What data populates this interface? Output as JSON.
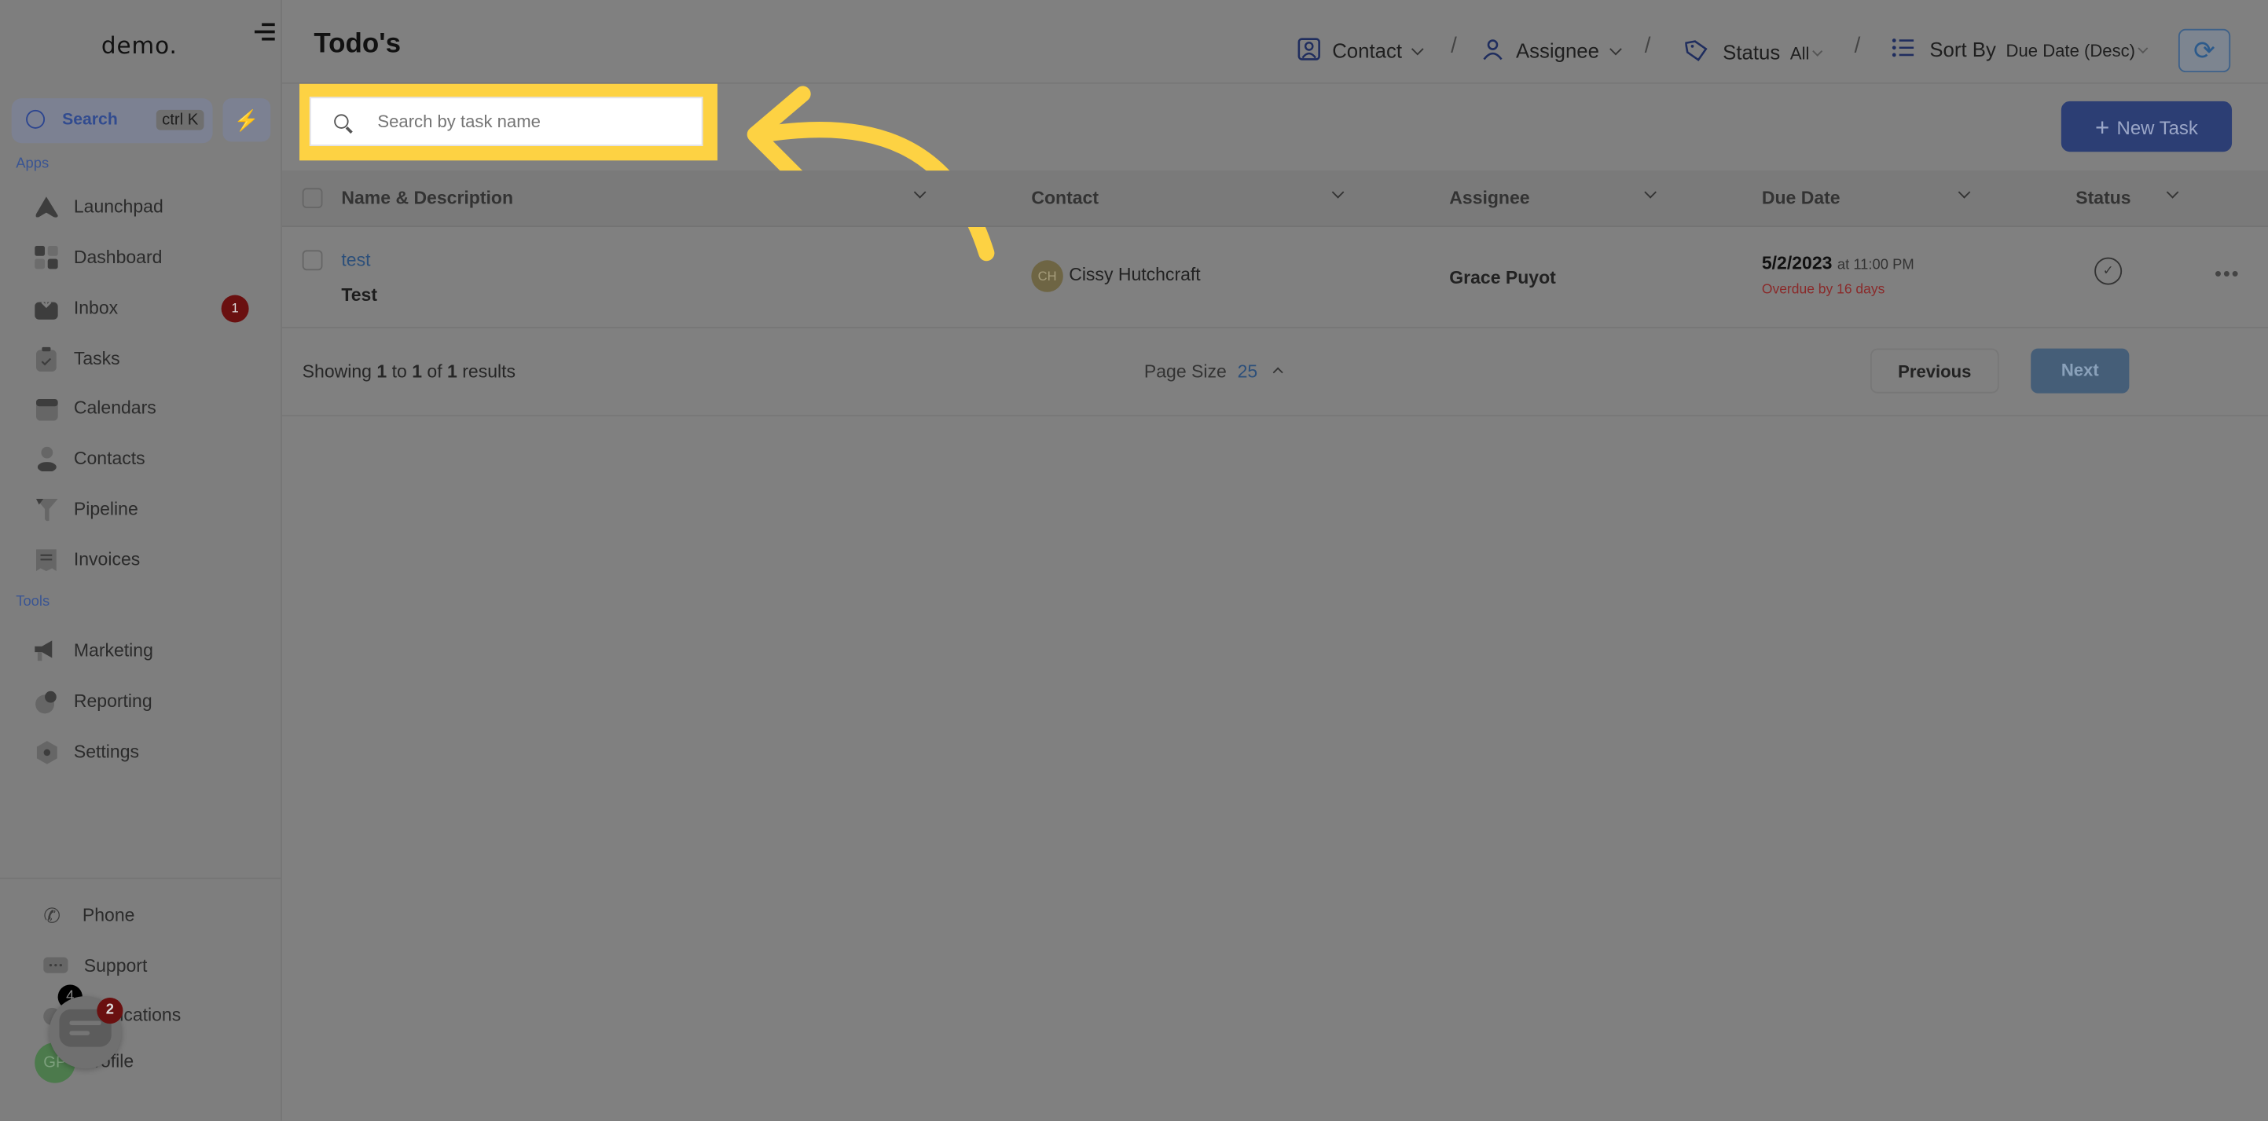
{
  "sidebar": {
    "logo": "demo.",
    "search": {
      "label": "Search",
      "shortcut": "ctrl K"
    },
    "sections": {
      "apps": "Apps",
      "tools": "Tools"
    },
    "apps": [
      {
        "label": "Launchpad",
        "icon": "launchpad-icon"
      },
      {
        "label": "Dashboard",
        "icon": "dashboard-icon"
      },
      {
        "label": "Inbox",
        "icon": "inbox-icon",
        "badge": "1"
      },
      {
        "label": "Tasks",
        "icon": "tasks-icon"
      },
      {
        "label": "Calendars",
        "icon": "calendar-icon"
      },
      {
        "label": "Contacts",
        "icon": "contacts-icon"
      },
      {
        "label": "Pipeline",
        "icon": "pipeline-icon"
      },
      {
        "label": "Invoices",
        "icon": "invoices-icon"
      }
    ],
    "tools": [
      {
        "label": "Marketing",
        "icon": "megaphone-icon"
      },
      {
        "label": "Reporting",
        "icon": "pie-chart-icon"
      },
      {
        "label": "Settings",
        "icon": "settings-icon"
      }
    ],
    "bottom": [
      {
        "label": "Phone",
        "icon": "phone-icon"
      },
      {
        "label": "Support",
        "icon": "support-icon"
      },
      {
        "label": "Notifications",
        "icon": "bell-icon",
        "badge": "4"
      },
      {
        "label": "Profile",
        "avatar": "GP"
      }
    ],
    "chat_widget_badge": "2"
  },
  "header": {
    "title": "Todo's",
    "filters": {
      "contact": "Contact",
      "assignee": "Assignee",
      "status_label": "Status",
      "status_value": "All",
      "sort_label": "Sort By",
      "sort_value": "Due Date (Desc)"
    }
  },
  "toolbar": {
    "search_placeholder": "Search by task name",
    "new_task": "New Task"
  },
  "table": {
    "columns": [
      "Name & Description",
      "Contact",
      "Assignee",
      "Due Date",
      "Status"
    ],
    "rows": [
      {
        "name": "test",
        "description": "Test",
        "contact_initials": "CH",
        "contact": "Cissy Hutchcraft",
        "assignee": "Grace Puyot",
        "due_date": "5/2/2023",
        "due_time": "at 11:00 PM",
        "overdue": "Overdue by 16 days"
      }
    ]
  },
  "pagination": {
    "showing_prefix": "Showing",
    "from": "1",
    "to_word": "to",
    "to": "1",
    "of_word": "of",
    "total": "1",
    "results_word": "results",
    "page_size_label": "Page Size",
    "page_size": "25",
    "previous": "Previous",
    "next": "Next"
  },
  "colors": {
    "highlight": "#fdd243",
    "accent": "#2c3e74",
    "overdue": "#a33a3a",
    "badge": "#6a1010"
  }
}
